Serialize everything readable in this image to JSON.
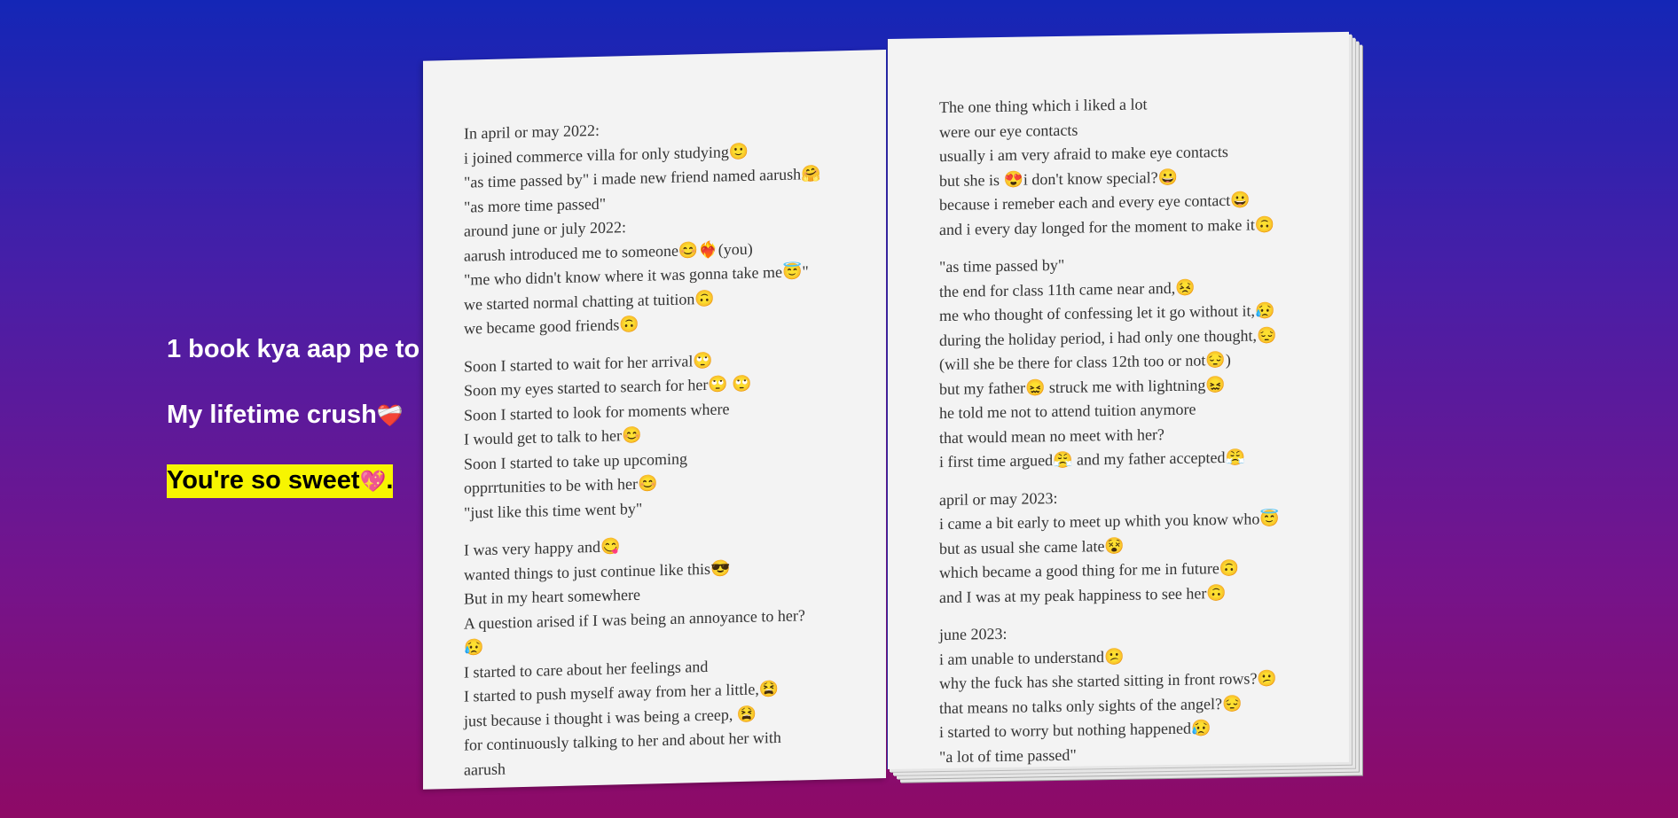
{
  "side": {
    "line1": "1 book kya aap pe to",
    "line2": "My lifetime crush",
    "line2_icon": "❤️‍🩹",
    "line3": "You're so sweet",
    "line3_icon": "💖",
    "line3_suffix": "."
  },
  "book": {
    "left_lines": [
      "In april or may 2022:",
      "i joined commerce villa for only studying🙂",
      "\"as time passed by\" i made new friend named aarush🤗",
      "\"as more time passed\"",
      "around june or july 2022:",
      "aarush introduced me to someone😊❤️‍🔥(you)",
      "\"me who didn't know where it was gonna take me😇\"",
      "we started normal chatting at tuition🙃",
      "we became good friends🙃",
      "",
      "Soon I started to wait for her arrival🙄",
      "Soon my eyes started to search for her🙄 🙄",
      "Soon I started to look for moments where",
      "I would get to talk to her😊",
      "Soon I started to take up upcoming",
      "opprrtunities to be with her😊",
      "\"just like this time went by\"",
      "",
      "I was very happy and😋",
      "wanted things to just continue like this😎",
      "But in my heart somewhere",
      "A question arised if I was being an annoyance to her?",
      "😥",
      "I started to care about her feelings and",
      "I started to push myself away from her a little,😫",
      "just because i thought i was being a creep, 😫",
      "for continuously talking to her and about her with",
      "aarush"
    ],
    "right_lines": [
      "The one thing which i liked a lot",
      "were our eye contacts",
      "usually i am very afraid to make eye contacts",
      "but she is 😍i don't know special?😀",
      "because i remeber each and every eye contact😀",
      "and i every day longed for the moment to make it🙃",
      "",
      "\"as time passed by\"",
      "the end for class 11th came near and,😣",
      "me who thought of confessing let it go without it,😥",
      "during the holiday period, i had only one thought,😔",
      "(will she be there for class 12th too or not😔)",
      "but my father😖 struck me with lightning😖",
      "he told me not to attend tuition anymore",
      "that would mean no meet with her?",
      "i first time argued😤 and my father accepted😤",
      "",
      "april or may 2023:",
      "i came a bit early to meet up whith you know who😇",
      "but as usual she came late😵",
      "which became a good thing for me in future🙃",
      "and I was at my peak happiness to see her🙃",
      "",
      "june 2023:",
      "i am unable to understand😕",
      "why the fuck has she started sitting in front rows?😕",
      "that means no talks only sights of the angel?😔",
      "i started to worry but nothing happened😥",
      "\"a lot of time passed\""
    ]
  }
}
